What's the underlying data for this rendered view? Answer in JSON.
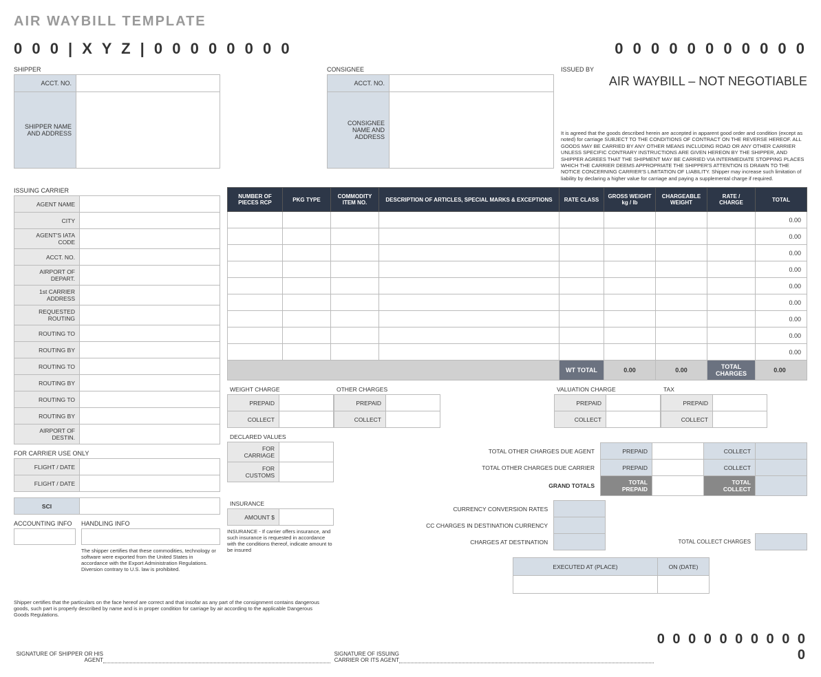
{
  "title": "AIR WAYBILL TEMPLATE",
  "code_left": "0 0 0 | X Y Z | 0 0 0 0  0 0 0 0",
  "code_right": "0 0 0   0 0 0 0   0 0 0 0",
  "shipper": {
    "label": "SHIPPER",
    "acct_label": "ACCT. NO.",
    "addr_label": "SHIPPER NAME AND ADDRESS",
    "acct": "",
    "addr": ""
  },
  "consignee": {
    "label": "CONSIGNEE",
    "acct_label": "ACCT. NO.",
    "addr_label": "CONSIGNEE NAME AND ADDRESS",
    "acct": "",
    "addr": ""
  },
  "issued": {
    "label": "ISSUED BY",
    "title": "AIR WAYBILL – NOT NEGOTIABLE",
    "legal": "It is agreed that the goods described herein are accepted in apparent good order and condition (except as noted) for carriage SUBJECT TO THE CONDITIONS OF CONTRACT ON THE REVERSE HEREOF. ALL GOODS MAY BE CARRIED BY ANY OTHER MEANS INCLUDING ROAD OR ANY OTHER CARRIER UNLESS SPECIFIC CONTRARY INSTRUCTIONS ARE GIVEN HEREON BY THE SHIPPER, AND SHIPPER AGREES THAT THE SHIPMENT MAY BE CARRIED VIA INTERMEDIATE STOPPING PLACES WHICH THE CARRIER DEEMS APPROPRIATE THE SHIPPER'S ATTENTION IS DRAWN TO THE NOTICE CONCERNING CARRIER'S LIMITATION OF LIABILITY. Shipper may increase such limitation of liability by declaring a higher value for carriage and paying a supplemental charge if required."
  },
  "carrier": {
    "label": "ISSUING CARRIER",
    "fields": [
      "AGENT NAME",
      "CITY",
      "AGENT'S IATA CODE",
      "ACCT. NO.",
      "AIRPORT OF DEPART.",
      "1st CARRIER ADDRESS",
      "REQUESTED ROUTING",
      "ROUTING TO",
      "ROUTING BY",
      "ROUTING TO",
      "ROUTING BY",
      "ROUTING TO",
      "ROUTING BY",
      "AIRPORT OF DESTIN."
    ]
  },
  "carrier_use": {
    "label": "FOR CARRIER USE ONLY",
    "fields": [
      "FLIGHT / DATE",
      "FLIGHT / DATE"
    ]
  },
  "sci": "SCI",
  "acct_info": "ACCOUNTING INFO",
  "handling_info": "HANDLING INFO",
  "items_header": {
    "c1": "NUMBER OF PIECES RCP",
    "c2": "PKG TYPE",
    "c3": "COMMODITY ITEM NO.",
    "c4": "DESCRIPTION OF ARTICLES, SPECIAL MARKS & EXCEPTIONS",
    "c5": "RATE CLASS",
    "c6": "GROSS WEIGHT kg / lb",
    "c7": "CHARGEABLE WEIGHT",
    "c8": "RATE / CHARGE",
    "c9": "TOTAL"
  },
  "items_totals": [
    "0.00",
    "0.00",
    "0.00",
    "0.00",
    "0.00",
    "0.00",
    "0.00",
    "0.00",
    "0.00"
  ],
  "footer": {
    "wt_total": "WT TOTAL",
    "wt1": "0.00",
    "wt2": "0.00",
    "tc": "TOTAL CHARGES",
    "tcv": "0.00"
  },
  "charges": {
    "weight": "WEIGHT CHARGE",
    "other": "OTHER CHARGES",
    "valuation": "VALUATION CHARGE",
    "tax": "TAX",
    "prepaid": "PREPAID",
    "collect": "COLLECT",
    "declared": "DECLARED VALUES",
    "carriage": "FOR CARRIAGE",
    "customs": "FOR CUSTOMS",
    "agent": "TOTAL OTHER CHARGES DUE AGENT",
    "due_carrier": "TOTAL OTHER CHARGES DUE CARRIER",
    "grand": "GRAND TOTALS",
    "total_prepaid": "TOTAL PREPAID",
    "total_collect": "TOTAL COLLECT",
    "ccr": "CURRENCY CONVERSION RATES",
    "ccdc": "CC CHARGES IN DESTINATION CURRENCY",
    "cad": "CHARGES AT DESTINATION",
    "tcc": "TOTAL COLLECT CHARGES"
  },
  "insurance": {
    "label": "INSURANCE",
    "amount": "AMOUNT $",
    "text": "INSURANCE - If carrier offers insurance, and such insurance is requested in accordance with the conditions thereof, indicate amount to be insured"
  },
  "handling_text": "The shipper certifies that these commodities, technology or software were exported from the United States in accordance with the Export Administration Regulations.  Diversion contrary to U.S. law is prohibited.",
  "shipper_cert": "Shipper certifies that the particulars on the face hereof are correct and that insofar as any part of the consignment contains dangerous goods, such part is properly described by name and is in proper condition for carriage by air according to the applicable Dangerous Goods Regulations.",
  "sig1": "SIGNATURE OF SHIPPER OR HIS AGENT",
  "sig2": "SIGNATURE OF ISSUING CARRIER OR ITS AGENT",
  "exec": {
    "place": "EXECUTED AT (PLACE)",
    "date": "ON (DATE)"
  },
  "bottom_code": "0 0 0   0 0 0 0   0 0 0 0"
}
